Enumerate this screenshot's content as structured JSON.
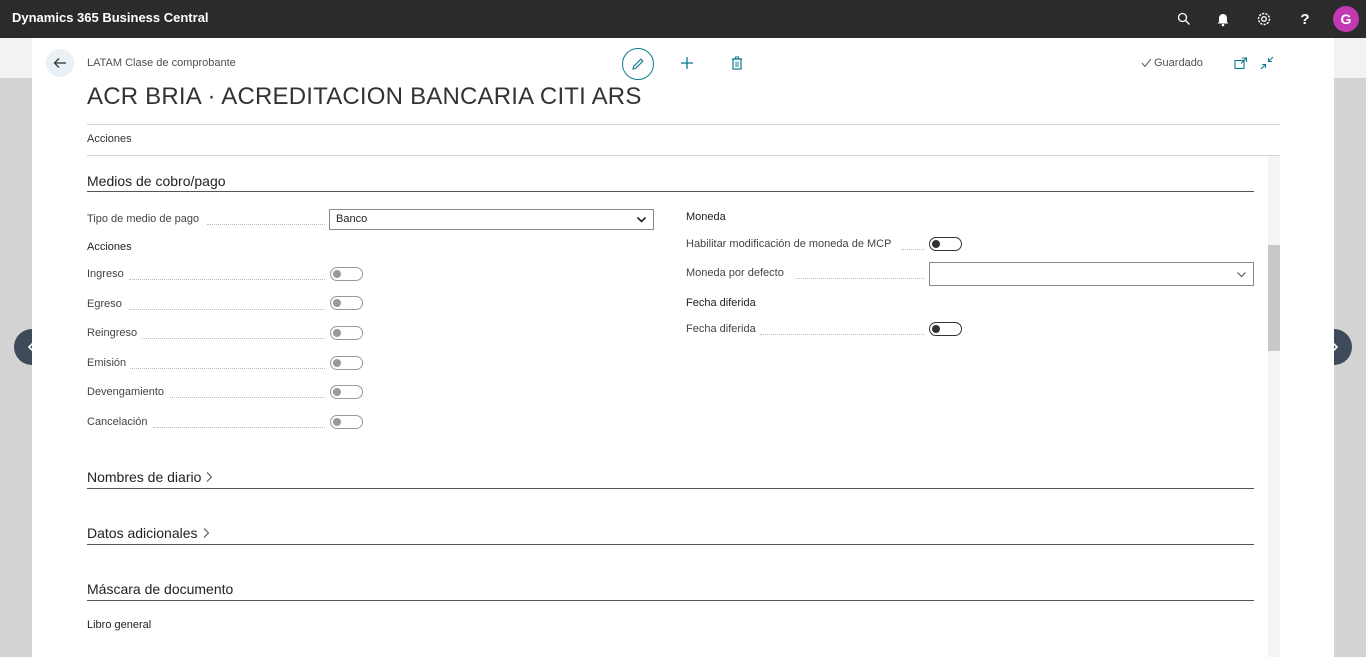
{
  "topbar": {
    "app_title": "Dynamics 365 Business Central",
    "icons": [
      "search-icon",
      "bell-icon",
      "gear-icon",
      "help-icon"
    ],
    "help_glyph": "?",
    "avatar_initial": "G"
  },
  "header": {
    "breadcrumb": "LATAM Clase de comprobante",
    "title": "ACR BRIA · ACREDITACION BANCARIA CITI ARS",
    "saved_label": "Guardado",
    "actions_menu": "Acciones"
  },
  "section_medios": {
    "title": "Medios de cobro/pago",
    "tipo_label": "Tipo de medio de pago",
    "tipo_value": "Banco",
    "acciones_heading": "Acciones",
    "toggles": [
      {
        "label": "Ingreso",
        "on": false
      },
      {
        "label": "Egreso",
        "on": false
      },
      {
        "label": "Reingreso",
        "on": false
      },
      {
        "label": "Emisión",
        "on": false
      },
      {
        "label": "Devengamiento",
        "on": false
      },
      {
        "label": "Cancelación",
        "on": false
      }
    ],
    "moneda_heading": "Moneda",
    "habilitar_label": "Habilitar modificación de moneda de MCP",
    "moneda_defecto_label": "Moneda por defecto",
    "moneda_defecto_value": "",
    "fecha_heading": "Fecha diferida",
    "fecha_label": "Fecha diferida"
  },
  "sections_collapsed": {
    "nombres_diario": "Nombres de diario",
    "datos_adicionales": "Datos adicionales"
  },
  "section_mascara": {
    "title": "Máscara de documento",
    "libro_label": "Libro general"
  },
  "colors": {
    "accent": "#0e7a8b",
    "topbar": "#2b2b2b",
    "avatar": "#c239b3"
  }
}
